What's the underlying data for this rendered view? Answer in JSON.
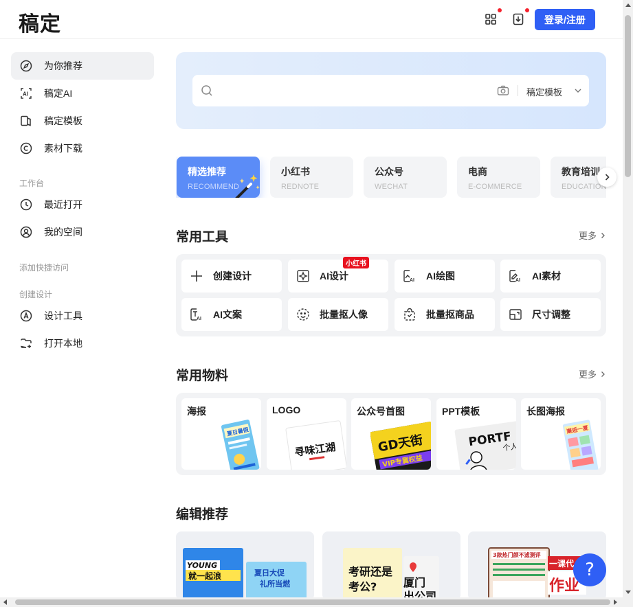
{
  "header": {
    "logo": "稿定",
    "login_label": "登录/注册"
  },
  "sidebar": {
    "items": [
      {
        "label": "为你推荐",
        "icon": "compass-icon"
      },
      {
        "label": "稿定AI",
        "icon": "ai-icon"
      },
      {
        "label": "稿定模板",
        "icon": "template-icon"
      },
      {
        "label": "素材下载",
        "icon": "copyright-icon"
      }
    ],
    "workspace_label": "工作台",
    "workspace_items": [
      {
        "label": "最近打开",
        "icon": "clock-icon"
      },
      {
        "label": "我的空间",
        "icon": "user-circle-icon"
      }
    ],
    "quick_access_label": "添加快捷访问",
    "create_label": "创建设计",
    "create_items": [
      {
        "label": "设计工具",
        "icon": "pen-icon"
      },
      {
        "label": "打开本地",
        "icon": "folder-plus-icon"
      }
    ]
  },
  "search": {
    "placeholder": "",
    "scope": "稿定模板"
  },
  "categories": [
    {
      "title": "精选推荐",
      "sub": "RECOMMEND"
    },
    {
      "title": "小红书",
      "sub": "REDNOTE"
    },
    {
      "title": "公众号",
      "sub": "WECHAT"
    },
    {
      "title": "电商",
      "sub": "E-COMMERCE"
    },
    {
      "title": "教育培训",
      "sub": "EDUCATION"
    }
  ],
  "tools_section": {
    "title": "常用工具",
    "more": "更多",
    "items": [
      {
        "label": "创建设计",
        "icon": "plus-icon"
      },
      {
        "label": "AI设计",
        "icon": "ai-design-icon",
        "badge": "小红书"
      },
      {
        "label": "AI绘图",
        "icon": "ai-draw-icon"
      },
      {
        "label": "AI素材",
        "icon": "ai-material-icon"
      },
      {
        "label": "AI文案",
        "icon": "ai-text-icon"
      },
      {
        "label": "批量抠人像",
        "icon": "face-cutout-icon"
      },
      {
        "label": "批量抠商品",
        "icon": "bag-cutout-icon"
      },
      {
        "label": "尺寸调整",
        "icon": "resize-icon"
      }
    ]
  },
  "materials_section": {
    "title": "常用物料",
    "more": "更多",
    "items": [
      {
        "label": "海报"
      },
      {
        "label": "LOGO"
      },
      {
        "label": "公众号首图"
      },
      {
        "label": "PPT模板"
      },
      {
        "label": "长图海报"
      }
    ],
    "thumb_text": {
      "poster": "夏日暑假",
      "logo": "寻味江湖",
      "wechat_big": "GD天街",
      "wechat_small": "VIP专属权益",
      "ppt_big": "PORTF",
      "ppt_small": "个人",
      "long": "邂逅一夏"
    }
  },
  "edits_section": {
    "title": "编辑推荐",
    "cards": [
      {
        "texts": [
          "YOUNG",
          "就一起浪",
          "夏日大促",
          "礼所当燃"
        ]
      },
      {
        "texts": [
          "考研还是",
          "考公?",
          "厦门",
          "出公司"
        ]
      },
      {
        "texts": [
          "3款热门颜不滤测评",
          "一课代",
          "作业"
        ]
      }
    ]
  },
  "help_label": "?",
  "colors": {
    "primary": "#2f5ff5",
    "active_category": "#5b8cf7",
    "badge": "#e8121f"
  }
}
